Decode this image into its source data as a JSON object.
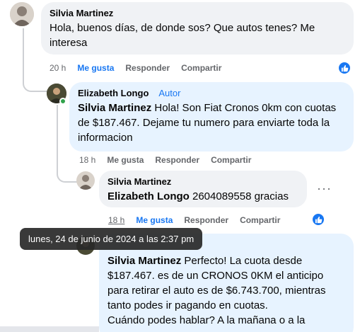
{
  "comment1": {
    "author": "Silvia Martinez",
    "text": "Hola, buenos días, de donde sos? Que autos tenes? Me interesa",
    "time": "20 h",
    "like": "Me gusta",
    "reply": "Responder",
    "share": "Compartir"
  },
  "comment2": {
    "author": "Elizabeth Longo",
    "badge": "Autor",
    "mention": "Silvia Martinez",
    "text": "Hola! Son Fiat Cronos 0km con cuotas de $187.467. Dejame tu numero para enviarte toda la informacion",
    "time": "18 h",
    "like": "Me gusta",
    "reply": "Responder",
    "share": "Compartir"
  },
  "comment3": {
    "author": "Silvia Martinez",
    "mention": "Elizabeth Longo",
    "text": "2604089558 gracias",
    "time": "18 h",
    "like": "Me gusta",
    "reply": "Responder",
    "share": "Compartir"
  },
  "comment4": {
    "mention": "Silvia Martinez",
    "text": "Perfecto! La cuota desde $187.467. es de un CRONOS 0KM el anticipo para retirar el auto es de $6.743.700, mientras tanto podes ir pagando en cuotas.\nCuándo podes hablar? A la mañana o a la"
  },
  "tooltip": "lunes, 24 de junio de 2024 a las 2:37 pm",
  "colors": {
    "accent": "#1877f2",
    "bubble": "#f0f2f5",
    "bubble_author": "#e7f3ff"
  }
}
